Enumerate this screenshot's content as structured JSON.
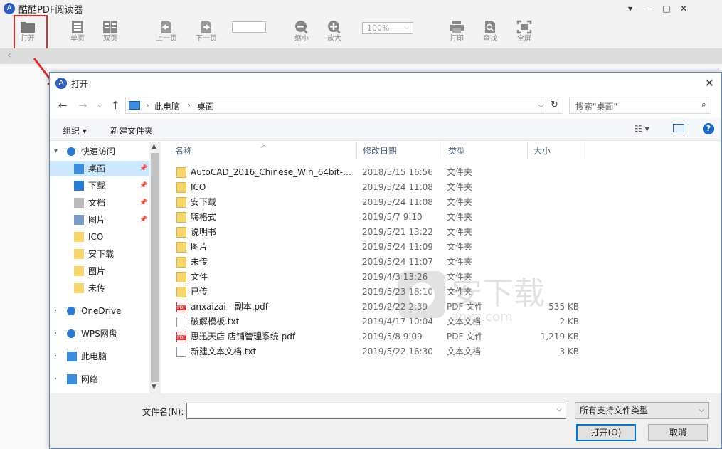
{
  "app": {
    "title": "酷酷PDF阅读器",
    "logo_glyph": "A",
    "window_controls": [
      "▾",
      "—",
      "□",
      "✕"
    ]
  },
  "toolbar": {
    "open": "打开",
    "single_page": "单页",
    "double_page": "双页",
    "prev_page": "上一页",
    "next_page": "下一页",
    "page_input": "",
    "zoom_out": "缩小",
    "zoom_in": "放大",
    "zoom_value": "100%",
    "print": "打印",
    "find": "查找",
    "fullscreen": "全屏"
  },
  "dialog": {
    "title": "打开",
    "breadcrumb": [
      "此电脑",
      "桌面"
    ],
    "search_placeholder": "搜索\"桌面\"",
    "organize": "组织 ▾",
    "new_folder": "新建文件夹",
    "help": "?",
    "nav": [
      {
        "label": "快速访问",
        "icon": "star-icon",
        "expander": "▾",
        "pinned": false,
        "selected": false
      },
      {
        "label": "桌面",
        "icon": "desktop-icon",
        "expander": "",
        "pinned": true,
        "selected": true
      },
      {
        "label": "下载",
        "icon": "download-icon",
        "expander": "",
        "pinned": true,
        "selected": false
      },
      {
        "label": "文档",
        "icon": "document-icon",
        "expander": "",
        "pinned": true,
        "selected": false
      },
      {
        "label": "图片",
        "icon": "picture-icon",
        "expander": "",
        "pinned": true,
        "selected": false
      },
      {
        "label": "ICO",
        "icon": "folder-icon",
        "expander": "",
        "pinned": false,
        "selected": false
      },
      {
        "label": "安下载",
        "icon": "folder-icon",
        "expander": "",
        "pinned": false,
        "selected": false
      },
      {
        "label": "图片",
        "icon": "folder-icon",
        "expander": "",
        "pinned": false,
        "selected": false
      },
      {
        "label": "未传",
        "icon": "folder-icon",
        "expander": "",
        "pinned": false,
        "selected": false
      },
      {
        "label": "OneDrive",
        "icon": "cloud-icon",
        "expander": "›",
        "pinned": false,
        "selected": false
      },
      {
        "label": "WPS网盘",
        "icon": "cloud-icon",
        "expander": "›",
        "pinned": false,
        "selected": false
      },
      {
        "label": "此电脑",
        "icon": "computer-icon",
        "expander": "›",
        "pinned": false,
        "selected": false
      },
      {
        "label": "网络",
        "icon": "network-icon",
        "expander": "›",
        "pinned": false,
        "selected": false
      }
    ],
    "columns": {
      "name": "名称",
      "modified": "修改日期",
      "type": "类型",
      "size": "大小"
    },
    "files": [
      {
        "name": "AutoCAD_2016_Chinese_Win_64bit-32...",
        "modified": "2018/5/15 16:56",
        "type": "文件夹",
        "size": "",
        "kind": "folder"
      },
      {
        "name": "ICO",
        "modified": "2019/5/24 11:08",
        "type": "文件夹",
        "size": "",
        "kind": "folder"
      },
      {
        "name": "安下载",
        "modified": "2019/5/24 11:08",
        "type": "文件夹",
        "size": "",
        "kind": "folder"
      },
      {
        "name": "嗨格式",
        "modified": "2019/5/7 9:10",
        "type": "文件夹",
        "size": "",
        "kind": "folder"
      },
      {
        "name": "说明书",
        "modified": "2019/5/21 13:22",
        "type": "文件夹",
        "size": "",
        "kind": "folder"
      },
      {
        "name": "图片",
        "modified": "2019/5/24 11:09",
        "type": "文件夹",
        "size": "",
        "kind": "folder"
      },
      {
        "name": "未传",
        "modified": "2019/5/24 11:07",
        "type": "文件夹",
        "size": "",
        "kind": "folder"
      },
      {
        "name": "文件",
        "modified": "2019/4/3 13:26",
        "type": "文件夹",
        "size": "",
        "kind": "folder"
      },
      {
        "name": "已传",
        "modified": "2019/5/23 18:10",
        "type": "文件夹",
        "size": "",
        "kind": "folder"
      },
      {
        "name": "anxaizai - 副本.pdf",
        "modified": "2019/2/22 2:39",
        "type": "PDF 文件",
        "size": "535 KB",
        "kind": "pdf"
      },
      {
        "name": "破解模板.txt",
        "modified": "2019/4/17 10:04",
        "type": "文本文档",
        "size": "2 KB",
        "kind": "txt"
      },
      {
        "name": "思迅天店 店铺管理系统.pdf",
        "modified": "2019/5/8 9:09",
        "type": "PDF 文件",
        "size": "1,219 KB",
        "kind": "pdf"
      },
      {
        "name": "新建文本文档.txt",
        "modified": "2019/5/22 16:30",
        "type": "文本文档",
        "size": "3 KB",
        "kind": "txt"
      }
    ],
    "filename_label": "文件名(N):",
    "filename_value": "",
    "filetype": "所有支持文件类型",
    "open_button": "打开(O)",
    "cancel_button": "取消"
  },
  "colors": {
    "highlight": "#e52a2a",
    "accent": "#0078d7",
    "selected_nav": "#cce8ff"
  }
}
